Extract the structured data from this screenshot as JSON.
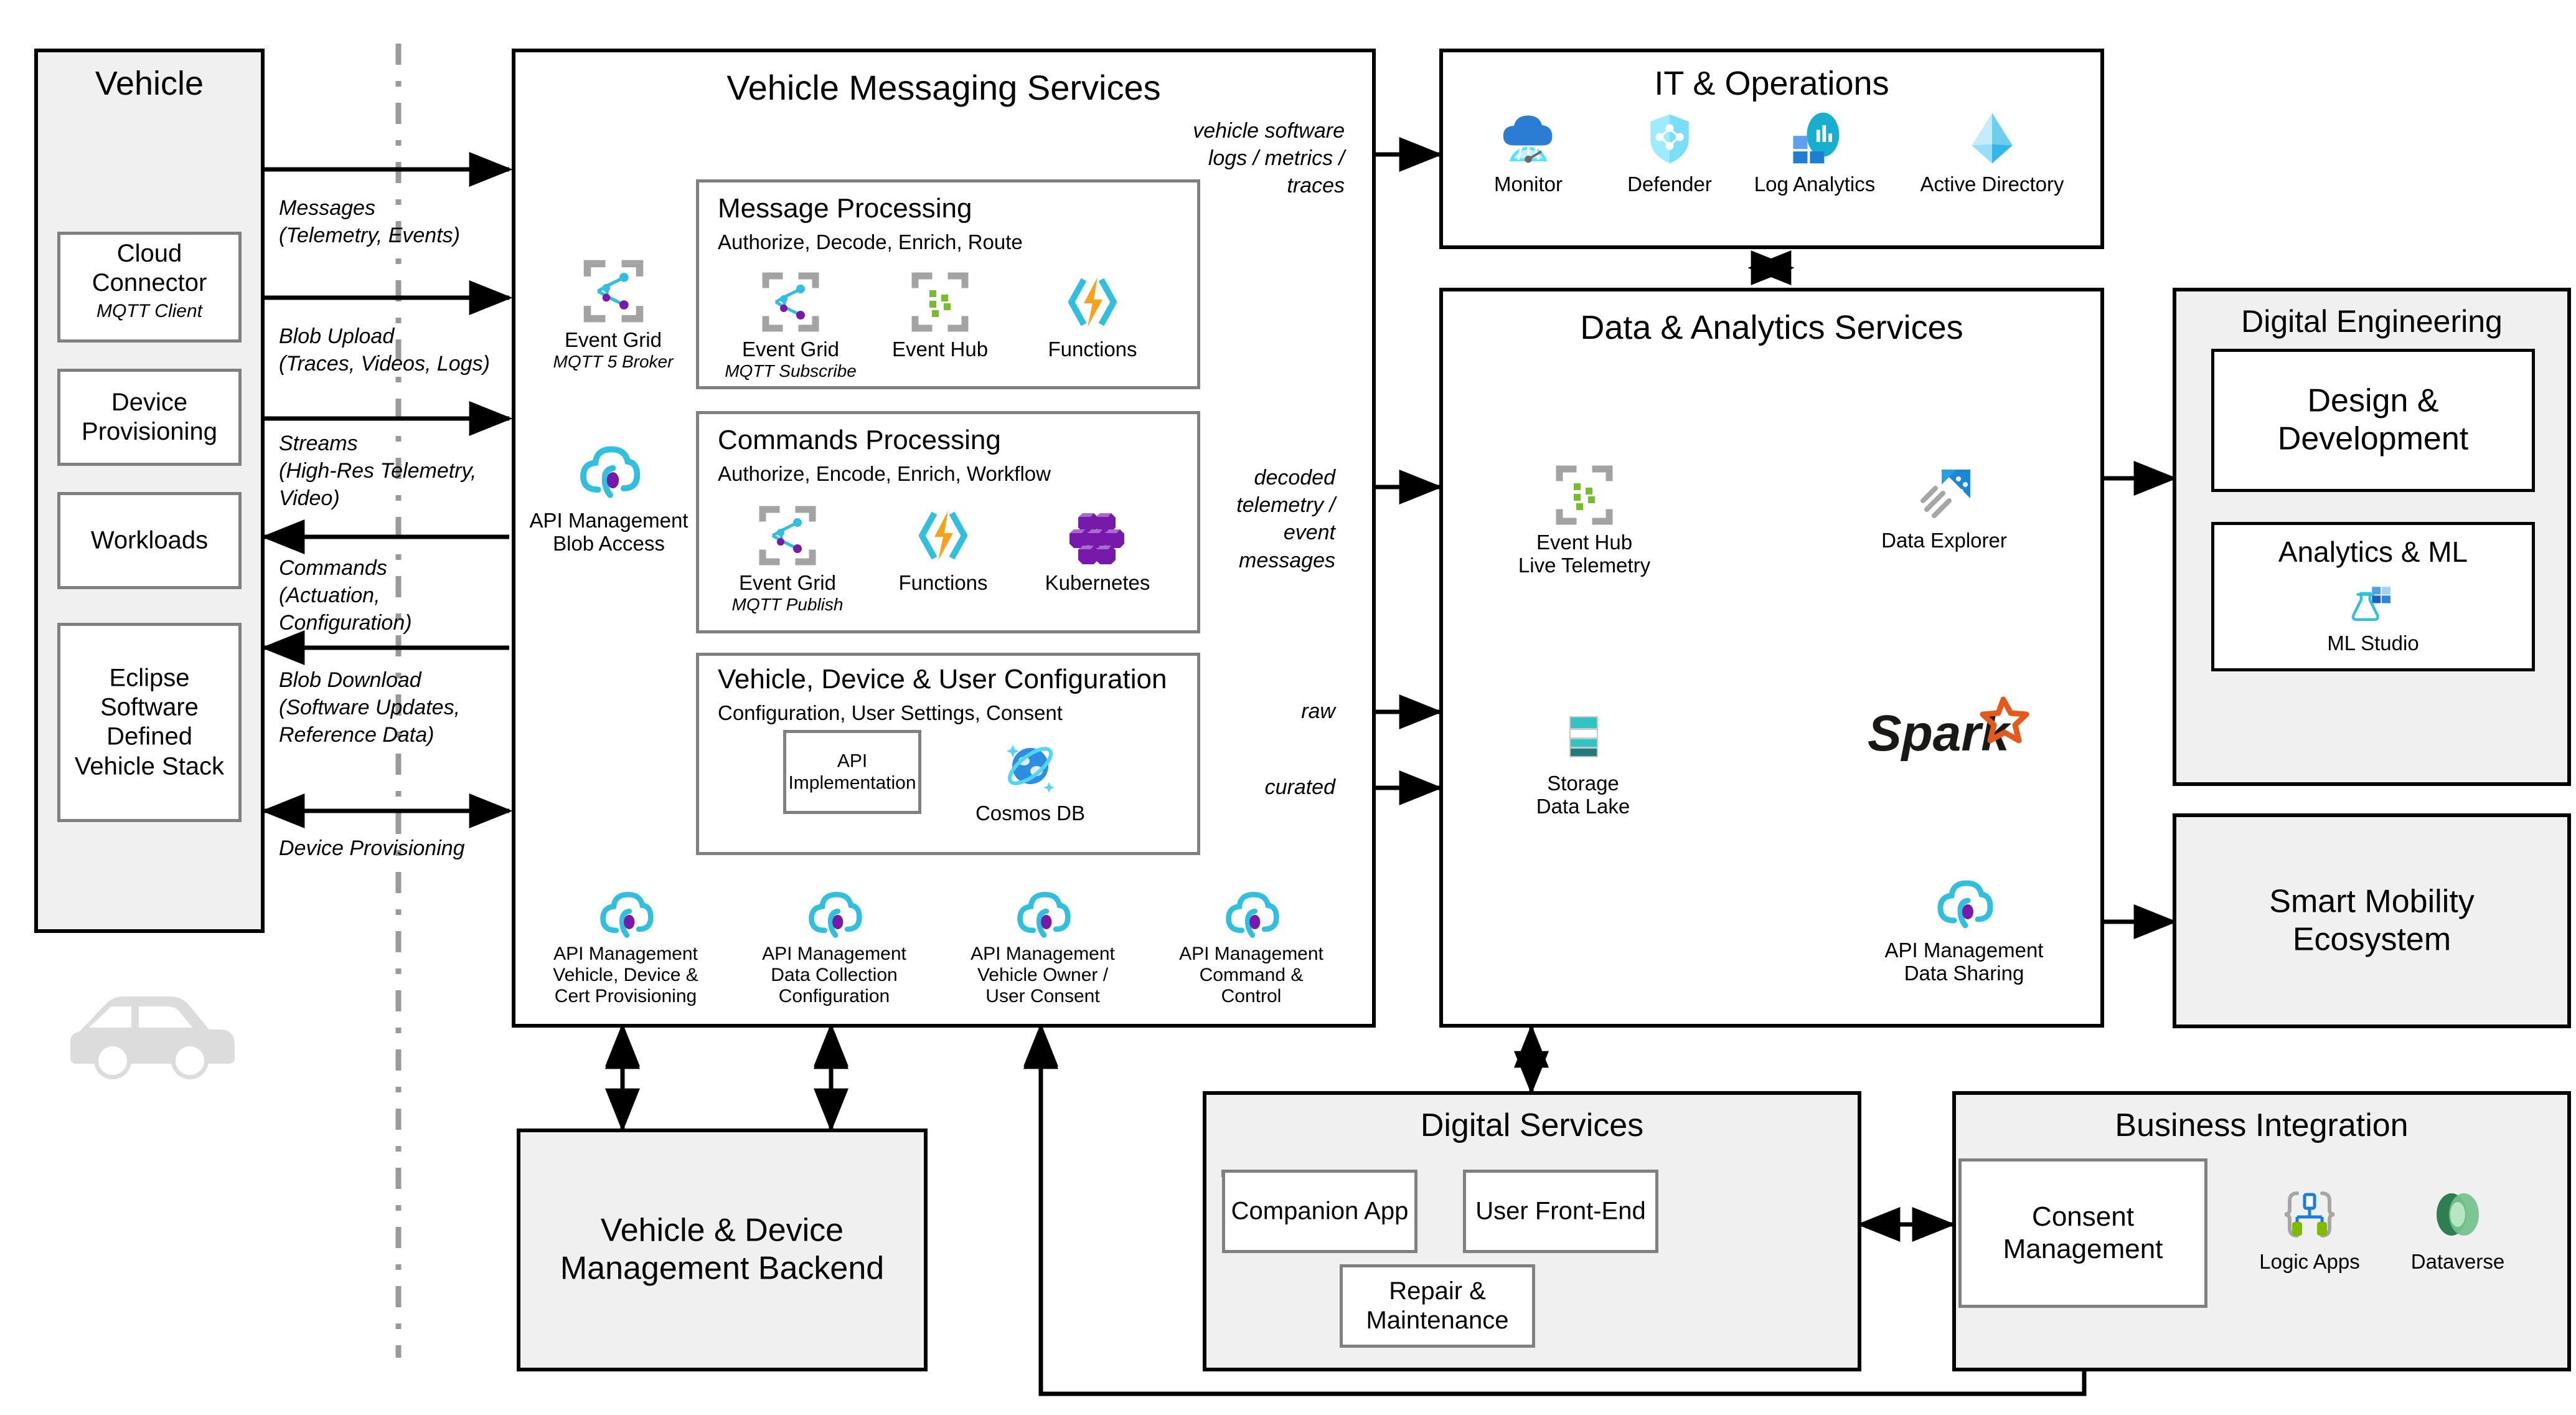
{
  "vehicle": {
    "title": "Vehicle",
    "items": [
      {
        "label": "Cloud\nConnector",
        "sub": "MQTT Client"
      },
      {
        "label": "Device\nProvisioning",
        "sub": ""
      },
      {
        "label": "Workloads",
        "sub": ""
      },
      {
        "label": "Eclipse\nSoftware\nDefined\nVehicle Stack",
        "sub": ""
      }
    ],
    "car_icon": "car-icon"
  },
  "edge_flows": [
    {
      "label": "Messages\n(Telemetry, Events)"
    },
    {
      "label": "Blob Upload\n(Traces, Videos, Logs)"
    },
    {
      "label": "Streams\n(High-Res Telemetry,\nVideo)"
    },
    {
      "label": "Commands\n(Actuation,\nConfiguration)"
    },
    {
      "label": "Blob Download\n(Software Updates,\nReference Data)"
    },
    {
      "label": "Device Provisioning"
    }
  ],
  "vms": {
    "title": "Vehicle Messaging Services",
    "left_services": [
      {
        "name": "Event Grid",
        "sub": "MQTT 5 Broker",
        "icon": "event-grid-icon"
      },
      {
        "name": "API Management\nBlob Access",
        "sub": "",
        "icon": "api-management-icon"
      }
    ],
    "message_processing": {
      "title": "Message Processing",
      "subtitle": "Authorize, Decode, Enrich, Route",
      "services": [
        {
          "name": "Event Grid",
          "sub": "MQTT Subscribe",
          "icon": "event-grid-icon"
        },
        {
          "name": "Event Hub",
          "sub": "",
          "icon": "event-hub-icon"
        },
        {
          "name": "Functions",
          "sub": "",
          "icon": "functions-icon"
        }
      ]
    },
    "commands_processing": {
      "title": "Commands Processing",
      "subtitle": "Authorize, Encode, Enrich, Workflow",
      "services": [
        {
          "name": "Event Grid",
          "sub": "MQTT Publish",
          "icon": "event-grid-icon"
        },
        {
          "name": "Functions",
          "sub": "",
          "icon": "functions-icon"
        },
        {
          "name": "Kubernetes",
          "sub": "",
          "icon": "kubernetes-icon"
        }
      ]
    },
    "configuration": {
      "title": "Vehicle, Device & User Configuration",
      "subtitle": "Configuration, User Settings, Consent",
      "api_box": "API\nImplementation",
      "services": [
        {
          "name": "Cosmos DB",
          "sub": "",
          "icon": "cosmos-db-icon"
        }
      ]
    },
    "apim_row": [
      {
        "name": "API Management\nVehicle, Device &\nCert Provisioning",
        "icon": "api-management-icon"
      },
      {
        "name": "API Management\nData Collection\nConfiguration",
        "icon": "api-management-icon"
      },
      {
        "name": "API Management\nVehicle Owner /\nUser Consent",
        "icon": "api-management-icon"
      },
      {
        "name": "API Management\nCommand &\nControl",
        "icon": "api-management-icon"
      }
    ]
  },
  "cloud_flows": [
    {
      "label": "vehicle software\nlogs / metrics / traces"
    },
    {
      "label": "decoded\ntelemetry /\nevent\nmessages"
    },
    {
      "label": "raw"
    },
    {
      "label": "curated"
    }
  ],
  "it_ops": {
    "title": "IT & Operations",
    "services": [
      {
        "name": "Monitor",
        "icon": "azure-monitor-icon"
      },
      {
        "name": "Defender",
        "icon": "defender-icon"
      },
      {
        "name": "Log Analytics",
        "icon": "log-analytics-icon"
      },
      {
        "name": "Active Directory",
        "icon": "active-directory-icon"
      }
    ]
  },
  "data_analytics": {
    "title": "Data & Analytics Services",
    "services": [
      {
        "name": "Event Hub\nLive Telemetry",
        "icon": "event-hub-icon"
      },
      {
        "name": "Data Explorer",
        "icon": "data-explorer-icon"
      },
      {
        "name": "Storage\nData Lake",
        "icon": "storage-icon"
      },
      {
        "name": "",
        "icon": "spark-icon"
      },
      {
        "name": "API Management\nData Sharing",
        "icon": "api-management-icon"
      }
    ]
  },
  "digital_engineering": {
    "title": "Digital Engineering",
    "design": "Design &\nDevelopment",
    "analytics": "Analytics & ML",
    "ml_studio": {
      "name": "ML Studio",
      "icon": "ml-studio-icon"
    }
  },
  "smart_mobility": {
    "title": "Smart Mobility\nEcosystem"
  },
  "backend": {
    "title": "Vehicle & Device\nManagement Backend"
  },
  "digital_services": {
    "title": "Digital Services",
    "items": [
      "Companion App",
      "User Front-End",
      "Repair &\nMaintenance"
    ]
  },
  "business_integration": {
    "title": "Business Integration",
    "consent": "Consent\nManagement",
    "services": [
      {
        "name": "Logic Apps",
        "icon": "logic-apps-icon"
      },
      {
        "name": "Dataverse",
        "icon": "dataverse-icon"
      }
    ]
  },
  "colors": {
    "group_fill": "#f0f0f0",
    "group_border": "#000000",
    "sub_border": "#808080",
    "azure_blue": "#0078d4",
    "cyan": "#32bedd",
    "purple": "#7719aa",
    "green": "#5e9624",
    "orange": "#f8a11a",
    "teal": "#32c3c3",
    "spark_orange": "#e25a1c"
  }
}
